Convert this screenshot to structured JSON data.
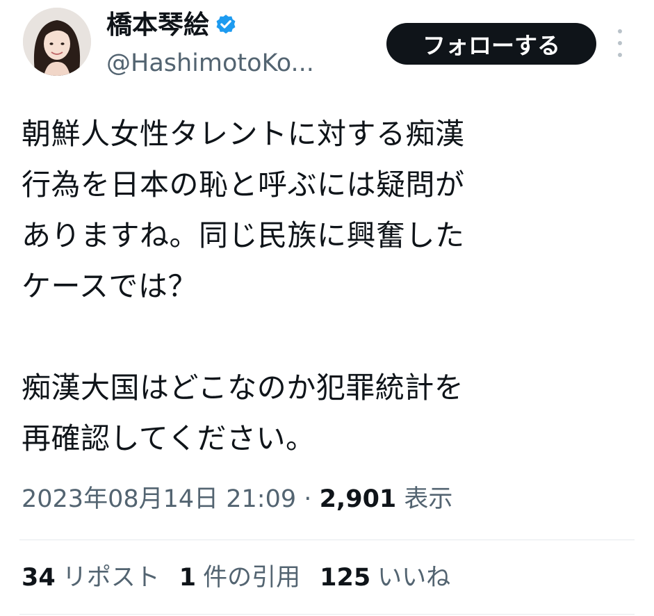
{
  "author": {
    "display_name": "橋本琴絵",
    "handle": "@HashimotoKo...",
    "verified_badge_color": "#1d9bf0"
  },
  "follow_button": {
    "label": "フォローする"
  },
  "more_menu": {
    "icon": "more-vertical-icon"
  },
  "tweet": {
    "paragraph1": [
      "朝鮮人女性タレントに対する痴漢",
      "行為を日本の恥と呼ぶには疑問が",
      "ありますね。同じ民族に興奮した",
      "ケースでは？"
    ],
    "paragraph2": [
      "痴漢大国はどこなのか犯罪統計を",
      "再確認してください。"
    ],
    "timestamp": "2023年08月14日 21:09",
    "separator": "·",
    "views_count": "2,901",
    "views_label": "表示"
  },
  "stats": {
    "reposts_count": "34",
    "reposts_label": "リポスト",
    "quotes_count": "1",
    "quotes_label": "件の引用",
    "likes_count": "125",
    "likes_label": "いいね"
  },
  "colors": {
    "text_primary": "#0f1419",
    "text_secondary": "#536471",
    "button_bg": "#0f1419",
    "divider": "#e6eaed"
  }
}
